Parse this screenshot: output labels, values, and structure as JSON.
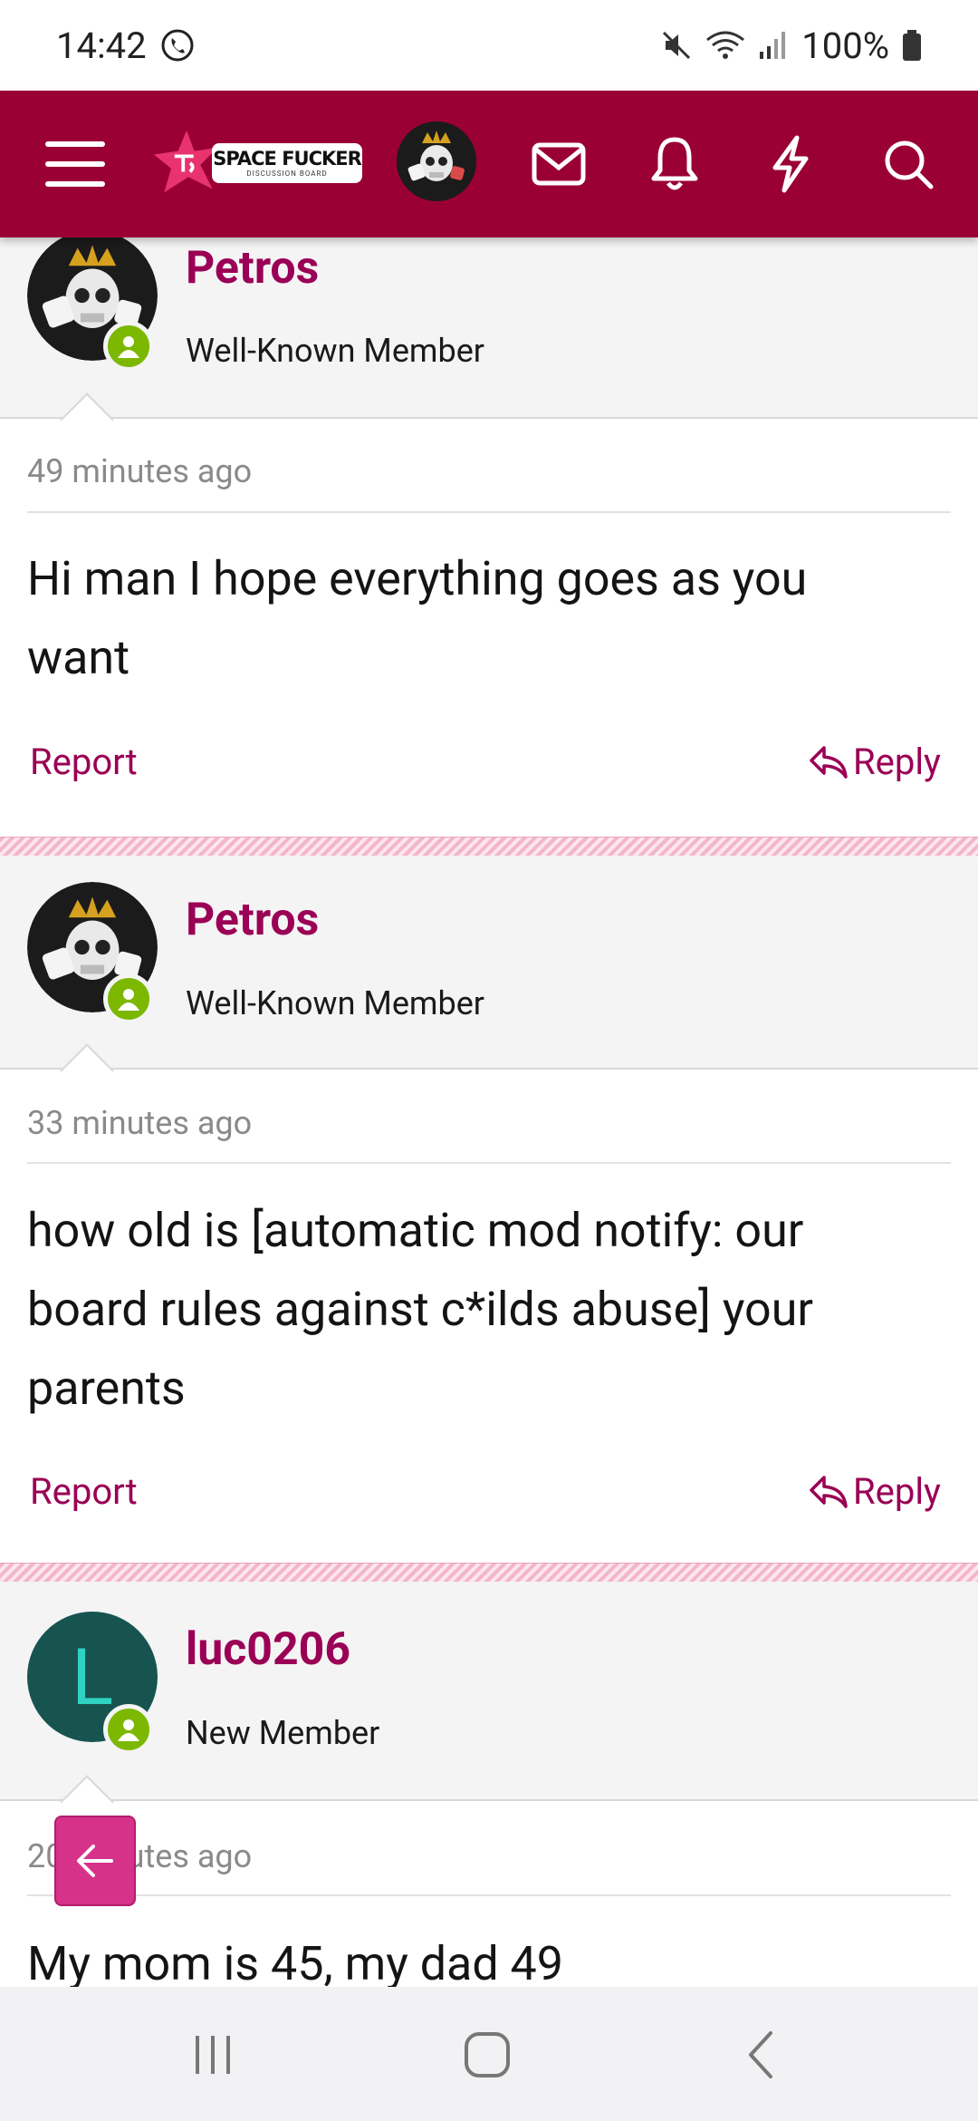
{
  "status_bar": {
    "time": "14:42",
    "battery": "100%"
  },
  "header": {
    "logo_title": "SPACE FUCKER",
    "logo_subtitle": "DISCUSSION BOARD",
    "brand_color": "#9a0033"
  },
  "posts": [
    {
      "username": "Petros",
      "user_title": "Well-Known Member",
      "time": "49 minutes ago",
      "body_lines": [
        "Hi man I hope everything goes as you",
        "want"
      ],
      "report_label": "Report",
      "reply_label": "Reply"
    },
    {
      "username": "Petros",
      "user_title": "Well-Known Member",
      "time": "33 minutes ago",
      "body_lines": [
        "how old is [automatic mod notify: our",
        "board rules against c*ilds abuse] your",
        "parents"
      ],
      "report_label": "Report",
      "reply_label": "Reply"
    },
    {
      "username": "luc0206",
      "avatar_letter": "L",
      "user_title": "New Member",
      "time": "20 minutes ago",
      "body_lines": [
        "My mom is 45, my dad 49"
      ]
    }
  ],
  "colors": {
    "accent": "#9a0055",
    "online": "#7cb800",
    "letter_avatar_bg": "#17544f",
    "letter_avatar_fg": "#2fd1c2",
    "fab": "#d6328a"
  }
}
